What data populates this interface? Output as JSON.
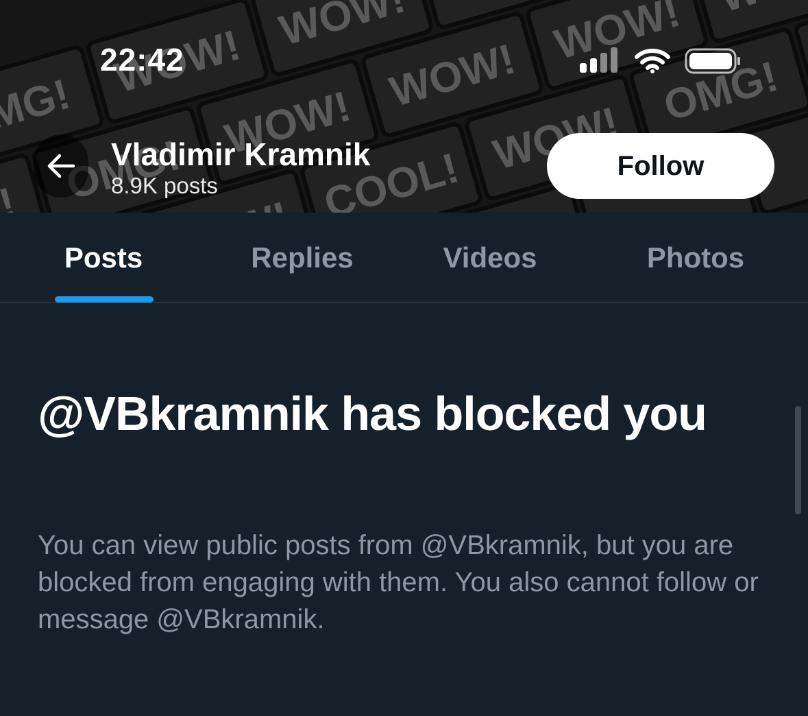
{
  "status_bar": {
    "time": "22:42",
    "icons": [
      "cellular-signal-icon",
      "wifi-icon",
      "battery-icon"
    ]
  },
  "header": {
    "back_icon": "arrow-left-icon",
    "name": "Vladimir Kramnik",
    "posts_count": "8.9K posts",
    "follow_label": "Follow",
    "banner_words": [
      "OMG!",
      "WOW!",
      "COOL!"
    ]
  },
  "tabs": [
    {
      "label": "Posts",
      "active": true
    },
    {
      "label": "Replies",
      "active": false
    },
    {
      "label": "Videos",
      "active": false
    },
    {
      "label": "Photos",
      "active": false
    }
  ],
  "blocked": {
    "title": "@VBkramnik has blocked you",
    "description": "You can view public posts from @VBkramnik, but you are blocked from engaging with them. You also cannot follow or message @VBkramnik."
  },
  "colors": {
    "background": "#15202b",
    "accent": "#1d9bf0",
    "muted_text": "#8b98a5",
    "divider": "#38444d"
  }
}
